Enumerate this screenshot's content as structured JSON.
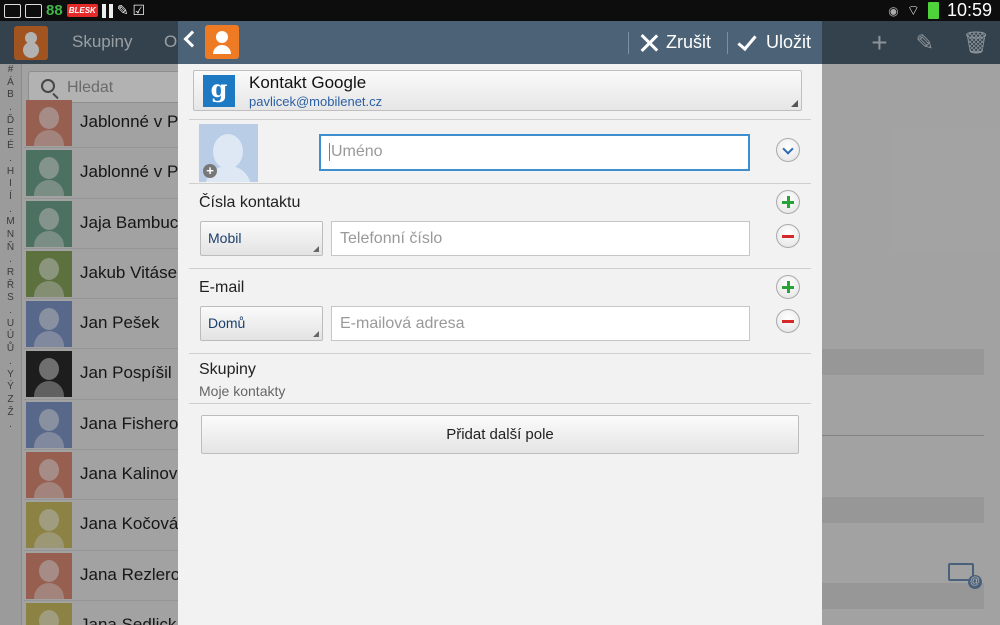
{
  "status_bar": {
    "notif_number": "88",
    "notif_brand": "BLESK",
    "time": "10:59",
    "icons": [
      "image-icon",
      "mail-icon",
      "numbers-icon",
      "blesk-icon",
      "pause-icon",
      "pencil-icon",
      "checkbox-icon",
      "eye-icon",
      "wifi-icon",
      "battery-icon"
    ]
  },
  "background_app": {
    "tabs": [
      "Skupiny",
      "Ol"
    ],
    "search_placeholder": "Hledat",
    "alphabet": [
      "#",
      "Á",
      "B",
      ".",
      "Ď",
      "E",
      "É",
      ".",
      "H",
      "I",
      "Í",
      ".",
      "M",
      "N",
      "Ň",
      ".",
      "R",
      "Ř",
      "S",
      ".",
      "U",
      "Ú",
      "Ů",
      ".",
      "Y",
      "Ý",
      "Z",
      "Ž",
      "."
    ],
    "contacts": [
      {
        "name": "Jablonné v Po",
        "color": "#d98873"
      },
      {
        "name": "Jablonné v P",
        "color": "#6fa28a"
      },
      {
        "name": "Jaja Bambuc",
        "color": "#6fa28a"
      },
      {
        "name": "Jakub Vitáse",
        "color": "#86a35a"
      },
      {
        "name": "Jan Pešek",
        "color": "#7e95c8"
      },
      {
        "name": "Jan Pospíšil",
        "color": "#2a2a2a"
      },
      {
        "name": "Jana Fishero",
        "color": "#7e95c8"
      },
      {
        "name": "Jana Kalinov",
        "color": "#d98873"
      },
      {
        "name": "Jana Kočová",
        "color": "#c7ba60"
      },
      {
        "name": "Jana Rezlero",
        "color": "#d98873"
      },
      {
        "name": "Jana Sedlick",
        "color": "#c7ba60"
      }
    ]
  },
  "dialog": {
    "header": {
      "cancel_label": "Zrušit",
      "save_label": "Uložit"
    },
    "account": {
      "title": "Kontakt Google",
      "email": "pavlicek@mobilenet.cz"
    },
    "name_field": {
      "placeholder": "Uméno"
    },
    "phone_section": {
      "label": "Čísla kontaktu",
      "type": "Mobil",
      "placeholder": "Telefonní číslo"
    },
    "email_section": {
      "label": "E-mail",
      "type": "Domů",
      "placeholder": "E-mailová adresa"
    },
    "groups_section": {
      "label": "Skupiny",
      "value": "Moje kontakty"
    },
    "add_field_label": "Přidat další pole"
  }
}
